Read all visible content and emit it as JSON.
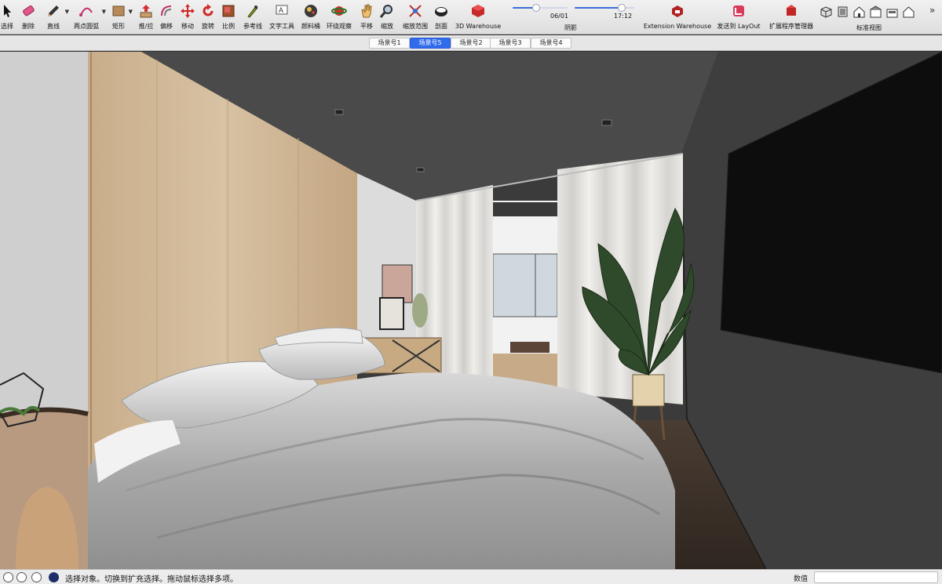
{
  "toolbar": {
    "tools": [
      {
        "id": "select",
        "label": "选择",
        "icon": "arrow-cursor-icon"
      },
      {
        "id": "eraser",
        "label": "删除",
        "icon": "eraser-icon"
      },
      {
        "id": "line",
        "label": "直线",
        "icon": "pencil-icon"
      },
      {
        "id": "arc",
        "label": "两点圆弧",
        "icon": "arc-icon"
      },
      {
        "id": "rect",
        "label": "矩形",
        "icon": "rectangle-icon"
      },
      {
        "id": "pushpull",
        "label": "推/拉",
        "icon": "push-pull-icon"
      },
      {
        "id": "offset",
        "label": "偏移",
        "icon": "offset-icon"
      },
      {
        "id": "move",
        "label": "移动",
        "icon": "move-icon"
      },
      {
        "id": "rotate",
        "label": "旋转",
        "icon": "rotate-icon"
      },
      {
        "id": "scale",
        "label": "比例",
        "icon": "scale-icon"
      },
      {
        "id": "tape",
        "label": "参考线",
        "icon": "tape-measure-icon"
      },
      {
        "id": "text",
        "label": "文字工具",
        "icon": "text-icon"
      },
      {
        "id": "paint",
        "label": "颜料桶",
        "icon": "paint-bucket-icon"
      },
      {
        "id": "orbit",
        "label": "环绕观察",
        "icon": "orbit-icon"
      },
      {
        "id": "pan",
        "label": "平移",
        "icon": "pan-hand-icon"
      },
      {
        "id": "zoom",
        "label": "缩放",
        "icon": "zoom-icon"
      },
      {
        "id": "zoomext",
        "label": "缩放范围",
        "icon": "zoom-extents-icon"
      },
      {
        "id": "section",
        "label": "剖面",
        "icon": "section-plane-icon"
      },
      {
        "id": "warehouse",
        "label": "3D Warehouse",
        "icon": "3d-warehouse-icon"
      }
    ],
    "shadow": {
      "label": "阴影",
      "date": "06/01",
      "time": "17:12",
      "date_fraction": 0.42,
      "time_fraction": 0.78
    },
    "extension_warehouse": {
      "label": "Extension Warehouse",
      "icon": "extension-warehouse-icon"
    },
    "send_layout": {
      "label": "发送到 LayOut",
      "icon": "layout-icon"
    },
    "extension_manager": {
      "label": "扩展程序管理器",
      "icon": "extension-manager-icon"
    },
    "standard_views": {
      "label": "标准视图",
      "icons": [
        "iso-view-icon",
        "top-view-icon",
        "front-view-icon",
        "right-view-icon",
        "back-view-icon",
        "left-view-icon"
      ]
    },
    "more": "»"
  },
  "scenes": {
    "tabs": [
      {
        "label": "场景号1",
        "active": false
      },
      {
        "label": "场景号5",
        "active": true
      },
      {
        "label": "场景号2",
        "active": false
      },
      {
        "label": "场景号3",
        "active": false
      },
      {
        "label": "场景号4",
        "active": false
      }
    ]
  },
  "status": {
    "message": "选择对象。切换到扩充选择。拖动鼠标选择多项。",
    "measurements_label": "数值",
    "measurements_value": "",
    "icons": [
      "geo-location-icon",
      "credits-icon",
      "user-account-icon",
      "instructor-icon"
    ]
  },
  "colors": {
    "ceiling": "#4a4a4a",
    "right_wall": "#3c3c3c",
    "wood_panel": "#cdb494",
    "left_wall": "#cfcfcf",
    "accent_active_tab": "#2f6bec"
  }
}
